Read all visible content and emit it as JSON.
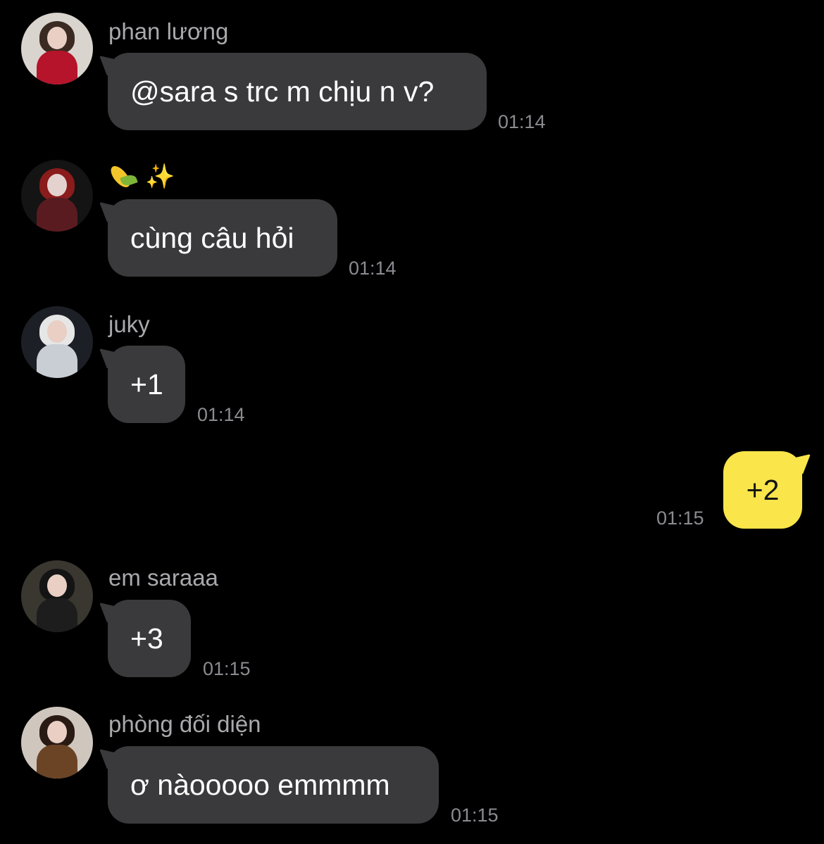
{
  "messages": [
    {
      "sender": "phan lương",
      "text": "@sara s trc m chịu n v?",
      "time": "01:14",
      "avatar_icon": "avatar-woman-red-dress"
    },
    {
      "sender_icons": [
        "corn-emoji",
        "sparkles-emoji"
      ],
      "text": "cùng câu hỏi",
      "time": "01:14",
      "avatar_icon": "avatar-woman-red-hair"
    },
    {
      "sender": "juky",
      "text": "+1",
      "time": "01:14",
      "avatar_icon": "avatar-woman-white-hair"
    },
    {
      "text": "+2",
      "time": "01:15",
      "outgoing": true
    },
    {
      "sender": "em saraaa",
      "text": "+3",
      "time": "01:15",
      "avatar_icon": "avatar-woman-night-street"
    },
    {
      "sender": "phòng đối diện",
      "text": "ơ nàooooo emmmm",
      "time": "01:15",
      "avatar_icon": "avatar-woman-brown-jacket"
    }
  ],
  "colors": {
    "background": "#000000",
    "incoming_bubble": "#3a3a3c",
    "outgoing_bubble": "#fae54a",
    "sender_name": "#a9a9ad",
    "timestamp": "#8b8b90"
  }
}
